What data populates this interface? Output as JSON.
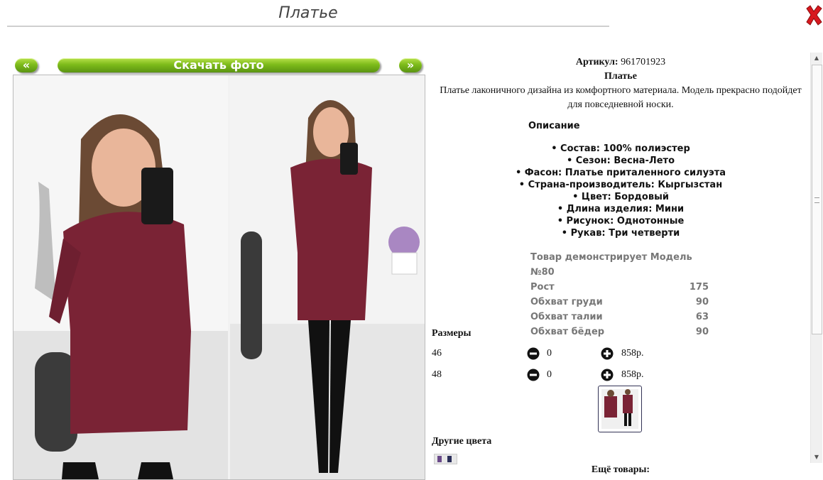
{
  "header": {
    "title": "Платье"
  },
  "nav": {
    "prev": "«",
    "next": "»",
    "download": "Скачать фото"
  },
  "product": {
    "article_label": "Артикул:",
    "article": "961701923",
    "name": "Платье",
    "description": "Платье лаконичного дизайна из комфортного материала. Модель прекрасно подойдет для повседневной носки."
  },
  "details": {
    "heading": "Описание",
    "features": [
      "• Состав: 100% полиэстер",
      "• Сезон: Весна-Лето",
      "• Фасон: Платье приталенного силуэта",
      "• Страна-производитель: Кыргызстан",
      "• Цвет: Бордовый",
      "• Длина изделия: Мини",
      "• Рисунок: Однотонные",
      "• Рукав: Три четверти"
    ]
  },
  "model": {
    "title": "Товар демонстрирует Модель №80",
    "rows": [
      {
        "label": "Рост",
        "value": "175"
      },
      {
        "label": "Обхват груди",
        "value": "90"
      },
      {
        "label": "Обхват талии",
        "value": "63"
      },
      {
        "label": "Обхват бёдер",
        "value": "90"
      }
    ]
  },
  "sizes": {
    "heading": "Размеры",
    "rows": [
      {
        "size": "46",
        "qty": "0",
        "price": "858р."
      },
      {
        "size": "48",
        "qty": "0",
        "price": "858р."
      }
    ]
  },
  "other_colors": {
    "heading": "Другие цвета"
  },
  "more": {
    "heading": "Ещё товары:"
  },
  "colors": {
    "accent_green": "#7dbb1a",
    "dress": "#7a2335",
    "close_red": "#d8181e"
  },
  "icons": [
    "close-icon",
    "minus-icon",
    "plus-icon",
    "scroll-up-icon",
    "scroll-down-icon"
  ]
}
